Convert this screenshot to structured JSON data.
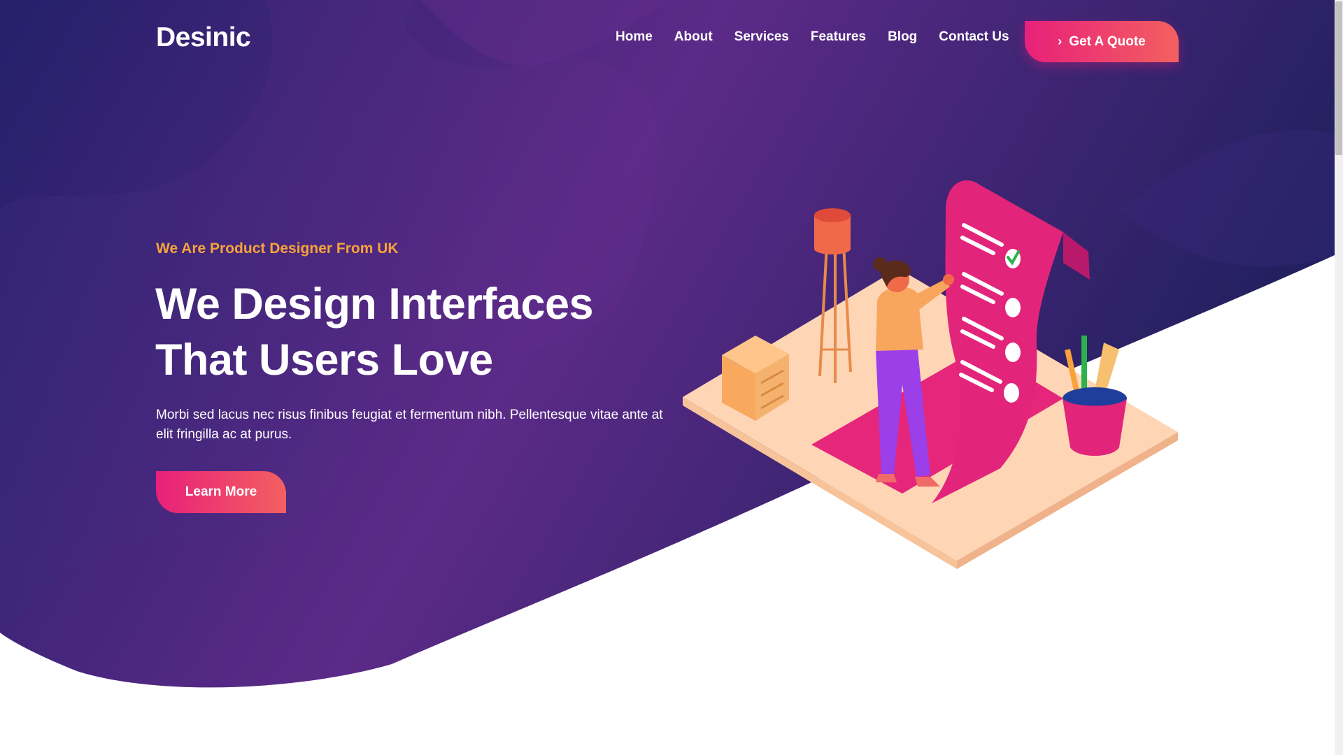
{
  "brand": {
    "logo_text": "Desinic"
  },
  "nav": {
    "items": [
      "Home",
      "About",
      "Services",
      "Features",
      "Blog",
      "Contact Us"
    ],
    "cta_label": "Get A Quote",
    "cta_icon": "chevron-right-icon"
  },
  "hero": {
    "eyebrow": "We Are Product Designer From UK",
    "headline_line1": "We Design Interfaces",
    "headline_line2": "That Users Love",
    "description": "Morbi sed lacus nec risus finibus feugiat et fermentum nibh. Pellentesque vitae ante at elit fringilla ac at purus.",
    "button_label": "Learn More"
  },
  "colors": {
    "hero_gradient": [
      "#2b1d6b",
      "#5a2a86",
      "#1f1c5c"
    ],
    "accent_pink": "#e8207a",
    "accent_coral": "#f36060",
    "eyebrow_orange": "#f7a33a"
  }
}
